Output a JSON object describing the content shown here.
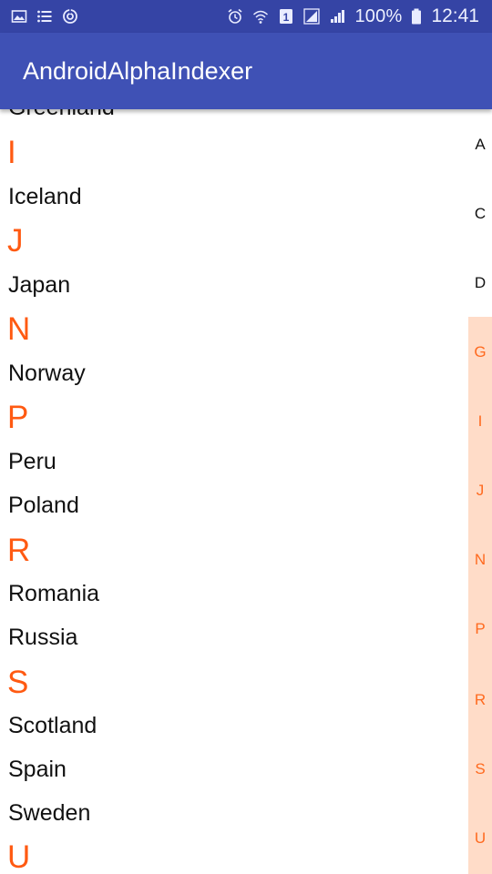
{
  "status_bar": {
    "battery_percent": "100%",
    "time": "12:41",
    "sim_slot": "1",
    "icons_left": [
      "gallery-icon",
      "list-icon",
      "sync-icon"
    ],
    "icons_right": [
      "alarm-icon",
      "wifi-icon",
      "sim-icon",
      "signal-icon",
      "signal-icon",
      "battery-icon"
    ]
  },
  "app_bar": {
    "title": "AndroidAlphaIndexer"
  },
  "list": {
    "partial_top": "Greenland",
    "entries": [
      {
        "type": "header",
        "text": "I"
      },
      {
        "type": "item",
        "text": "Iceland"
      },
      {
        "type": "header",
        "text": "J"
      },
      {
        "type": "item",
        "text": "Japan"
      },
      {
        "type": "header",
        "text": "N"
      },
      {
        "type": "item",
        "text": "Norway"
      },
      {
        "type": "header",
        "text": "P"
      },
      {
        "type": "item",
        "text": "Peru"
      },
      {
        "type": "item",
        "text": "Poland"
      },
      {
        "type": "header",
        "text": "R"
      },
      {
        "type": "item",
        "text": "Romania"
      },
      {
        "type": "item",
        "text": "Russia"
      },
      {
        "type": "header",
        "text": "S"
      },
      {
        "type": "item",
        "text": "Scotland"
      },
      {
        "type": "item",
        "text": "Spain"
      },
      {
        "type": "item",
        "text": "Sweden"
      },
      {
        "type": "header",
        "text": "U"
      }
    ]
  },
  "indexer": {
    "letters": [
      {
        "text": "A",
        "highlighted": false
      },
      {
        "text": "C",
        "highlighted": false
      },
      {
        "text": "D",
        "highlighted": false
      },
      {
        "text": "G",
        "highlighted": true
      },
      {
        "text": "I",
        "highlighted": true
      },
      {
        "text": "J",
        "highlighted": true
      },
      {
        "text": "N",
        "highlighted": true
      },
      {
        "text": "P",
        "highlighted": true
      },
      {
        "text": "R",
        "highlighted": true
      },
      {
        "text": "S",
        "highlighted": true
      },
      {
        "text": "U",
        "highlighted": true
      }
    ]
  },
  "colors": {
    "status_bar": "#3544a5",
    "app_bar": "#3f51b5",
    "section_header": "#ff5a12",
    "indexer_highlight_bg": "#ffdcc8",
    "indexer_highlight_text": "#ff6a1f"
  }
}
